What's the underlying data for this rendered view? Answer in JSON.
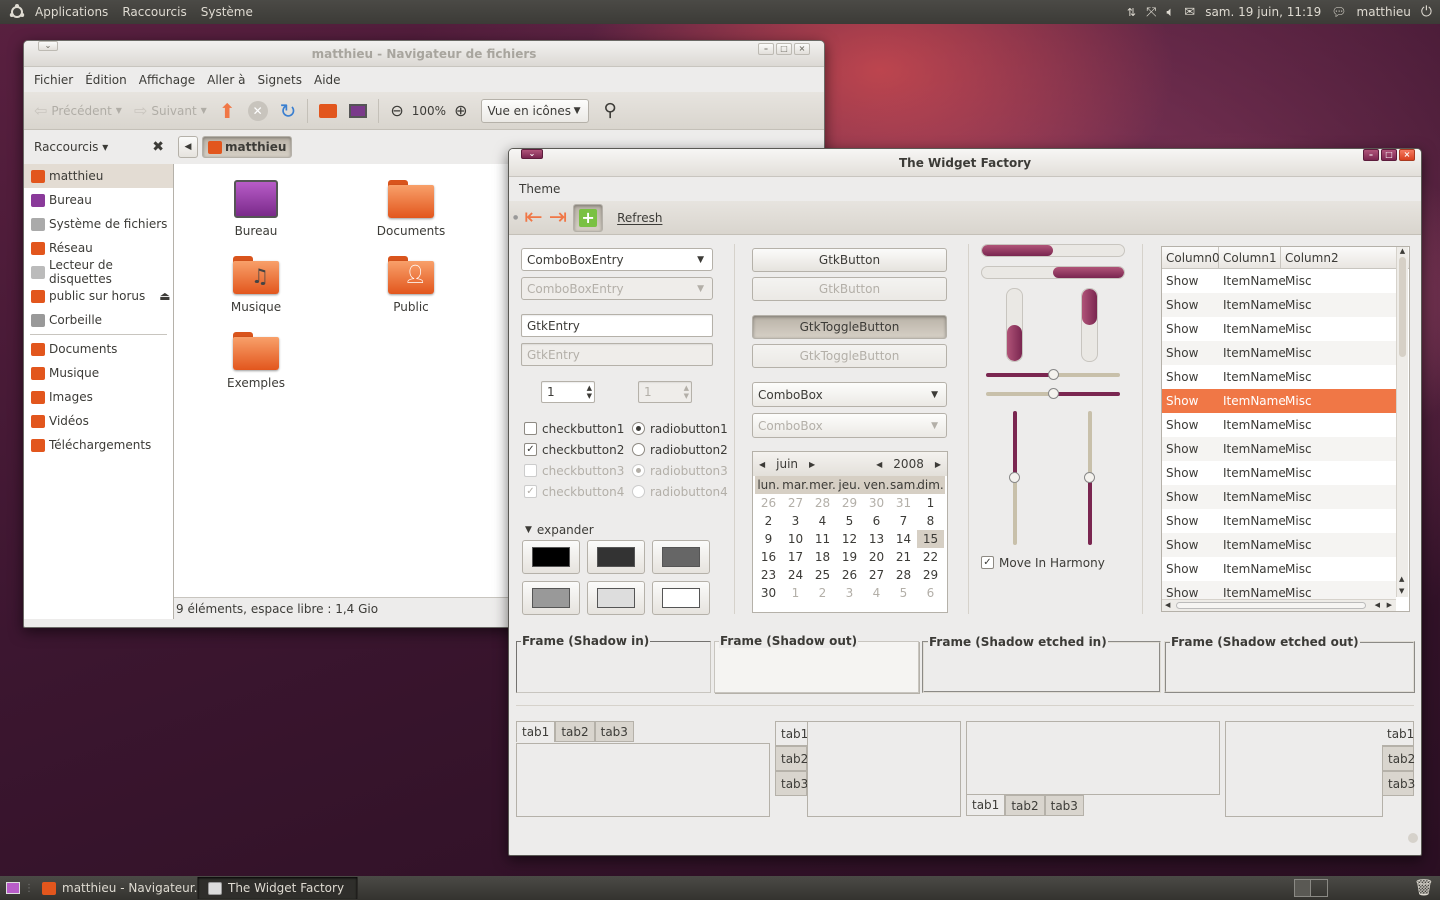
{
  "top_panel": {
    "menus": [
      "Applications",
      "Raccourcis",
      "Système"
    ],
    "clock": "sam. 19 juin, 11:19",
    "user": "matthieu"
  },
  "bottom_panel": {
    "tasks": [
      "matthieu - Navigateur...",
      "The Widget Factory"
    ]
  },
  "file_manager": {
    "title": "matthieu - Navigateur de fichiers",
    "menus": [
      "Fichier",
      "Édition",
      "Affichage",
      "Aller à",
      "Signets",
      "Aide"
    ],
    "toolbar": {
      "back": "Précédent",
      "forward": "Suivant",
      "zoom": "100%",
      "view_mode": "Vue en icônes"
    },
    "sidebar_title": "Raccourcis",
    "location": "matthieu",
    "sidebar_items": [
      "matthieu",
      "Bureau",
      "Système de fichiers",
      "Réseau",
      "Lecteur de disquettes",
      "public sur horus",
      "Corbeille"
    ],
    "bookmarks": [
      "Documents",
      "Musique",
      "Images",
      "Vidéos",
      "Téléchargements"
    ],
    "files": [
      "Bureau",
      "Documents",
      "Musique",
      "Public",
      "Exemples"
    ],
    "status": "9 éléments, espace libre : 1,4 Gio"
  },
  "widget_factory": {
    "title": "The Widget Factory",
    "menu": "Theme",
    "toolbar_refresh": "Refresh",
    "combo_entry": "ComboBoxEntry",
    "entry": "GtkEntry",
    "spin_value": "1",
    "checkbuttons": [
      "checkbutton1",
      "checkbutton2",
      "checkbutton3",
      "checkbutton4"
    ],
    "radiobuttons": [
      "radiobutton1",
      "radiobutton2",
      "radiobutton3",
      "radiobutton4"
    ],
    "expander": "expander",
    "swatch_colors": [
      "#000000",
      "#333333",
      "#666666",
      "#999999",
      "#dddddd",
      "#ffffff"
    ],
    "button": "GtkButton",
    "toggle_button": "GtkToggleButton",
    "combobox": "ComboBox",
    "calendar": {
      "month": "juin",
      "year": "2008",
      "days": [
        "lun.",
        "mar.",
        "mer.",
        "jeu.",
        "ven.",
        "sam.",
        "dim."
      ],
      "weeks": [
        [
          "26",
          "27",
          "28",
          "29",
          "30",
          "31",
          "1"
        ],
        [
          "2",
          "3",
          "4",
          "5",
          "6",
          "7",
          "8"
        ],
        [
          "9",
          "10",
          "11",
          "12",
          "13",
          "14",
          "15"
        ],
        [
          "16",
          "17",
          "18",
          "19",
          "20",
          "21",
          "22"
        ],
        [
          "23",
          "24",
          "25",
          "26",
          "27",
          "28",
          "29"
        ],
        [
          "30",
          "1",
          "2",
          "3",
          "4",
          "5",
          "6"
        ]
      ],
      "today": "15"
    },
    "move_in_harmony": "Move In Harmony",
    "tree": {
      "columns": [
        "Column0",
        "Column1",
        "Column2"
      ],
      "row": [
        "Show",
        "ItemName",
        "Misc"
      ],
      "row_count": 14,
      "selected_row": 5
    },
    "frames": [
      "Frame (Shadow in)",
      "Frame (Shadow out)",
      "Frame (Shadow etched in)",
      "Frame (Shadow etched out)"
    ],
    "tabs": [
      "tab1",
      "tab2",
      "tab3"
    ],
    "accent_color": "#f07746",
    "progress": [
      0.5,
      0.5
    ]
  }
}
